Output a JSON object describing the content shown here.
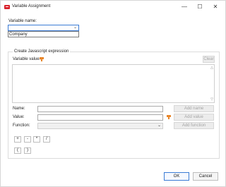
{
  "window": {
    "title": "Variable Assignment",
    "controls": {
      "minimize": "—",
      "maximize": "☐",
      "close": "✕"
    }
  },
  "variable": {
    "label": "Variable name:",
    "selected": "",
    "options": [
      "Company"
    ]
  },
  "js": {
    "group_title": "Create Javascript expression",
    "value_label": "Variable value:",
    "clear": "Clear"
  },
  "fields": {
    "name_label": "Name:",
    "value_label": "Value:",
    "function_label": "Function:",
    "add_name": "Add name",
    "add_value": "Add value",
    "add_function": "Add function"
  },
  "operators": [
    "+",
    "-",
    "*",
    "/",
    "(",
    ")"
  ],
  "footer": {
    "ok": "OK",
    "cancel": "Cancel"
  },
  "colors": {
    "accent": "#3a7bd5",
    "brand": "#d9232d",
    "flag": "#e8862a"
  },
  "icons": {
    "app": "app-icon",
    "flag": "flag-icon",
    "chevron": "chevron-down-icon"
  }
}
